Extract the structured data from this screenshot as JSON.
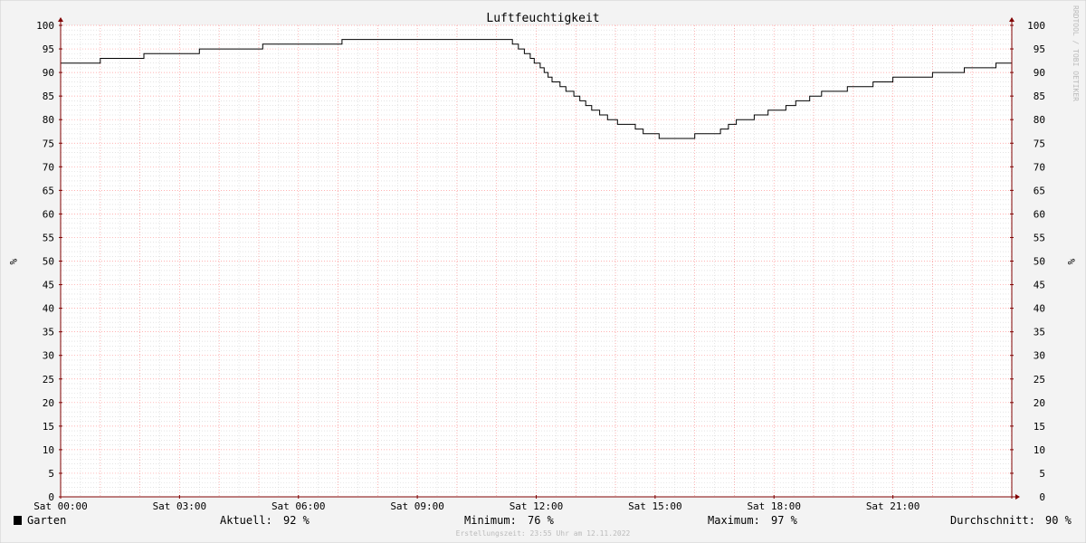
{
  "chart_data": {
    "type": "line",
    "title": "Luftfeuchtigkeit",
    "ylabel_left": "%",
    "ylabel_right": "%",
    "ylim": [
      0,
      100
    ],
    "xlim_hours": [
      0,
      24
    ],
    "y_ticks": [
      "0",
      "5",
      "10",
      "15",
      "20",
      "25",
      "30",
      "35",
      "40",
      "45",
      "50",
      "55",
      "60",
      "65",
      "70",
      "75",
      "80",
      "85",
      "90",
      "95",
      "100"
    ],
    "x_ticks": [
      {
        "hour": 0,
        "label": "Sat 00:00"
      },
      {
        "hour": 3,
        "label": "Sat 03:00"
      },
      {
        "hour": 6,
        "label": "Sat 06:00"
      },
      {
        "hour": 9,
        "label": "Sat 09:00"
      },
      {
        "hour": 12,
        "label": "Sat 12:00"
      },
      {
        "hour": 15,
        "label": "Sat 15:00"
      },
      {
        "hour": 18,
        "label": "Sat 18:00"
      },
      {
        "hour": 21,
        "label": "Sat 21:00"
      }
    ],
    "grid": true,
    "series": [
      {
        "name": "Garten",
        "color": "#000000",
        "steps": [
          [
            0.0,
            92
          ],
          [
            1.0,
            93
          ],
          [
            2.1,
            94
          ],
          [
            3.5,
            95
          ],
          [
            5.1,
            96
          ],
          [
            7.1,
            97
          ],
          [
            11.4,
            96
          ],
          [
            11.55,
            95
          ],
          [
            11.7,
            94
          ],
          [
            11.85,
            93
          ],
          [
            11.95,
            92
          ],
          [
            12.1,
            91
          ],
          [
            12.2,
            90
          ],
          [
            12.3,
            89
          ],
          [
            12.4,
            88
          ],
          [
            12.6,
            87
          ],
          [
            12.75,
            86
          ],
          [
            12.95,
            85
          ],
          [
            13.1,
            84
          ],
          [
            13.25,
            83
          ],
          [
            13.4,
            82
          ],
          [
            13.6,
            81
          ],
          [
            13.8,
            80
          ],
          [
            14.05,
            79
          ],
          [
            14.5,
            78
          ],
          [
            14.7,
            77
          ],
          [
            15.1,
            76
          ],
          [
            16.0,
            77
          ],
          [
            16.65,
            78
          ],
          [
            16.85,
            79
          ],
          [
            17.05,
            80
          ],
          [
            17.5,
            81
          ],
          [
            17.85,
            82
          ],
          [
            18.3,
            83
          ],
          [
            18.55,
            84
          ],
          [
            18.9,
            85
          ],
          [
            19.2,
            86
          ],
          [
            19.85,
            87
          ],
          [
            20.5,
            88
          ],
          [
            21.0,
            89
          ],
          [
            22.0,
            90
          ],
          [
            22.8,
            91
          ],
          [
            23.6,
            92
          ],
          [
            24.0,
            92
          ]
        ]
      }
    ]
  },
  "legend": {
    "series_name": "Garten",
    "swatch_color": "#000000"
  },
  "stats": {
    "current_label": "Aktuell:",
    "current_value": "92 %",
    "min_label": "Minimum:",
    "min_value": "76 %",
    "max_label": "Maximum:",
    "max_value": "97 %",
    "avg_label": "Durchschnitt:",
    "avg_value": "90 %"
  },
  "footer": "Erstellungszeit: 23:55 Uhr am 12.11.2022",
  "watermark": "RRDTOOL / TOBI OETIKER",
  "colors": {
    "background": "#f3f3f3",
    "plot_background": "#ffffff",
    "major_grid": "#ff9999",
    "minor_grid": "#d4d4d4",
    "axis": "#800000",
    "line": "#000000",
    "text": "#000000",
    "faint_text": "#bbbbbb"
  }
}
